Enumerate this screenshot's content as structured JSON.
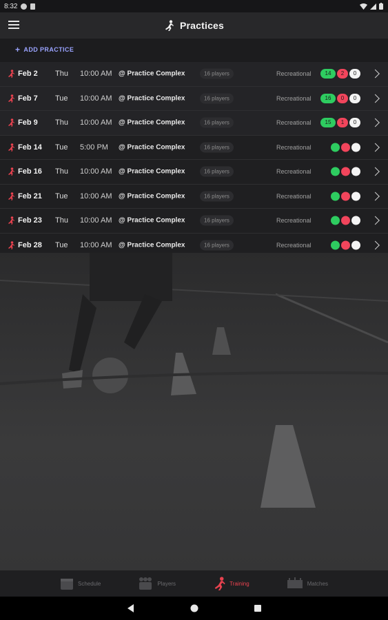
{
  "status_bar": {
    "time": "8:32"
  },
  "app_bar": {
    "title": "Practices"
  },
  "actions": {
    "add_practice": "ADD PRACTICE"
  },
  "practices": [
    {
      "date": "Feb 2",
      "day": "Thu",
      "time": "10:00 AM",
      "location": "@ Practice Complex",
      "players": "16 players",
      "level": "Recreational",
      "counts": [
        "14",
        "2",
        "0"
      ]
    },
    {
      "date": "Feb 7",
      "day": "Tue",
      "time": "10:00 AM",
      "location": "@ Practice Complex",
      "players": "16 players",
      "level": "Recreational",
      "counts": [
        "16",
        "0",
        "0"
      ]
    },
    {
      "date": "Feb 9",
      "day": "Thu",
      "time": "10:00 AM",
      "location": "@ Practice Complex",
      "players": "16 players",
      "level": "Recreational",
      "counts": [
        "15",
        "1",
        "0"
      ]
    },
    {
      "date": "Feb 14",
      "day": "Tue",
      "time": "5:00 PM",
      "location": "@ Practice Complex",
      "players": "16 players",
      "level": "Recreational"
    },
    {
      "date": "Feb 16",
      "day": "Thu",
      "time": "10:00 AM",
      "location": "@ Practice Complex",
      "players": "16 players",
      "level": "Recreational"
    },
    {
      "date": "Feb 21",
      "day": "Tue",
      "time": "10:00 AM",
      "location": "@ Practice Complex",
      "players": "16 players",
      "level": "Recreational"
    },
    {
      "date": "Feb 23",
      "day": "Thu",
      "time": "10:00 AM",
      "location": "@ Practice Complex",
      "players": "16 players",
      "level": "Recreational"
    },
    {
      "date": "Feb 28",
      "day": "Tue",
      "time": "10:00 AM",
      "location": "@ Practice Complex",
      "players": "16 players",
      "level": "Recreational"
    }
  ],
  "bottom_nav": [
    {
      "label": "Schedule",
      "icon": "calendar-icon"
    },
    {
      "label": "Players",
      "icon": "players-icon"
    },
    {
      "label": "Training",
      "icon": "training-icon",
      "active": true
    },
    {
      "label": "Matches",
      "icon": "stadium-icon"
    }
  ],
  "colors": {
    "accent": "#e9424f",
    "attending": "#2ecc60",
    "absent": "#f2455c",
    "unknown": "#f4f4f4",
    "link": "#9aa3ff"
  }
}
